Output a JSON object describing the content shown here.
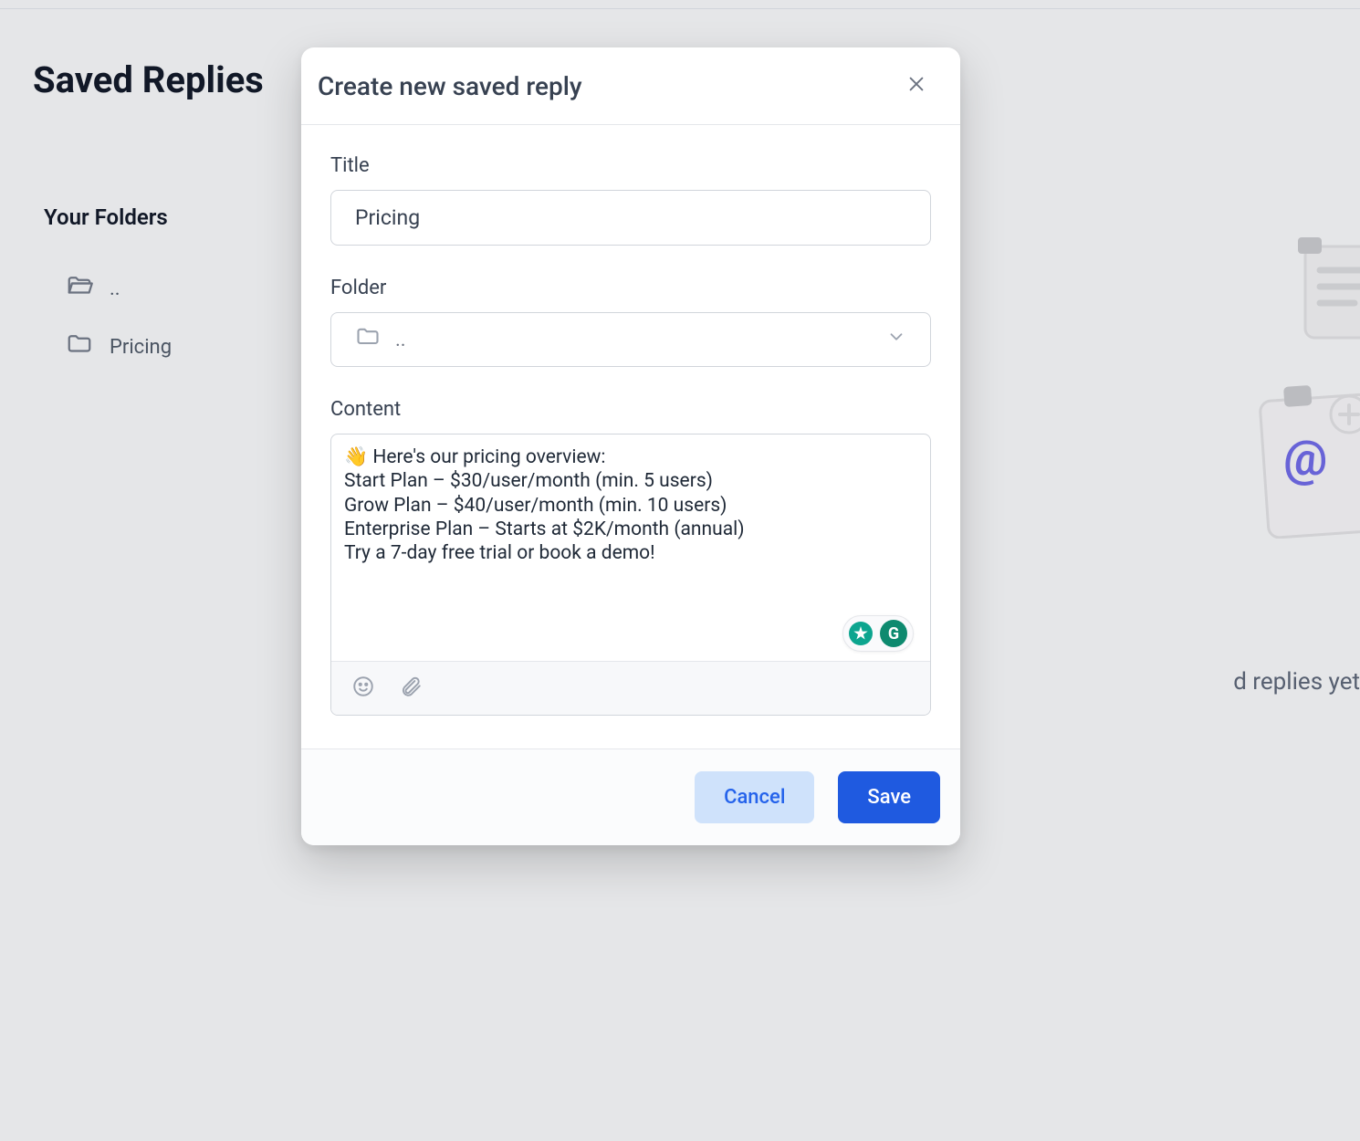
{
  "page": {
    "title": "Saved Replies",
    "folders_heading": "Your Folders",
    "folders": [
      {
        "label": ".."
      },
      {
        "label": "Pricing"
      }
    ],
    "empty_text": "d replies yet"
  },
  "modal": {
    "title": "Create new saved reply",
    "fields": {
      "title_label": "Title",
      "title_value": "Pricing",
      "folder_label": "Folder",
      "folder_value": "..",
      "content_label": "Content",
      "content_value": "👋 Here's our pricing overview:\nStart Plan – $30/user/month (min. 5 users)\nGrow Plan – $40/user/month (min. 10 users)\nEnterprise Plan – Starts at $2K/month (annual)\nTry a 7-day free trial or book a demo!"
    },
    "actions": {
      "cancel": "Cancel",
      "save": "Save"
    },
    "assistant_badge": "G"
  }
}
